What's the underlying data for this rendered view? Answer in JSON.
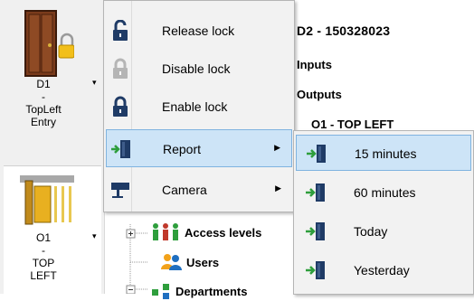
{
  "left_panel": {
    "door_tile": {
      "name_lines": [
        "D1",
        "-",
        "TopLeft",
        "Entry"
      ],
      "arrow": "▾",
      "icon": "door-locked-icon"
    },
    "output_tile": {
      "name_lines": [
        "O1",
        "-",
        "TOP",
        "LEFT"
      ],
      "arrow": "▾",
      "icon": "electric-strike-icon"
    }
  },
  "details": {
    "title": "D2 - 150328023",
    "inputs_label": "Inputs",
    "outputs_label": "Outputs",
    "output_item": "O1 - TOP LEFT"
  },
  "tree": {
    "items": [
      {
        "label": "Access levels",
        "icon": "access-levels-icon"
      },
      {
        "label": "Users",
        "icon": "users-icon"
      },
      {
        "label": "Departments",
        "icon": "departments-icon"
      }
    ]
  },
  "context_menu": {
    "items": [
      {
        "label": "Release lock",
        "icon": "lock-open-icon",
        "has_submenu": false
      },
      {
        "label": "Disable lock",
        "icon": "lock-disabled-icon",
        "has_submenu": false
      },
      {
        "label": "Enable lock",
        "icon": "lock-closed-icon",
        "has_submenu": false
      },
      {
        "label": "Report",
        "icon": "report-door-icon",
        "has_submenu": true
      },
      {
        "label": "Camera",
        "icon": "camera-icon",
        "has_submenu": true
      }
    ],
    "submenu_arrow": "▶"
  },
  "report_submenu": {
    "items": [
      {
        "label": "15 minutes",
        "icon": "report-door-icon"
      },
      {
        "label": "60 minutes",
        "icon": "report-door-icon"
      },
      {
        "label": "Today",
        "icon": "report-door-icon"
      },
      {
        "label": "Yesterday",
        "icon": "report-door-icon"
      }
    ]
  },
  "colors": {
    "menu_background": "#f2f2f2",
    "highlight": "#cde4f7",
    "highlight_border": "#7fb3e0",
    "icon_dark_blue": "#1f3b66",
    "icon_green": "#2e9e3c"
  }
}
